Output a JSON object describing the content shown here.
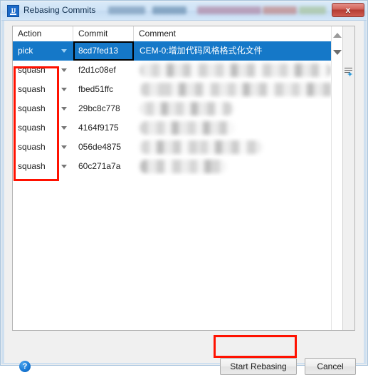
{
  "window": {
    "title": "Rebasing Commits",
    "app_icon": "intellij-idea-icon",
    "close_label": "x",
    "redacted_title_suffix": true
  },
  "table": {
    "columns": [
      "Action",
      "Commit",
      "Comment"
    ],
    "rows": [
      {
        "action": "pick",
        "commit": "8cd7fed13",
        "comment": "CEM-0:增加代码风格格式化文件",
        "selected": true,
        "comment_redacted": false,
        "focused_cell": "commit"
      },
      {
        "action": "squash",
        "commit": "f2d1c08ef",
        "comment": "",
        "selected": false,
        "comment_redacted": true,
        "comment_width": 270
      },
      {
        "action": "squash",
        "commit": "fbed51ffc",
        "comment": "",
        "selected": false,
        "comment_redacted": true,
        "comment_width": 278
      },
      {
        "action": "squash",
        "commit": "29bc8c778",
        "comment": "",
        "selected": false,
        "comment_redacted": true,
        "comment_width": 132
      },
      {
        "action": "squash",
        "commit": "4164f9175",
        "comment": "",
        "selected": false,
        "comment_redacted": true,
        "comment_width": 134
      },
      {
        "action": "squash",
        "commit": "056de4875",
        "comment": "",
        "selected": false,
        "comment_redacted": true,
        "comment_width": 172
      },
      {
        "action": "squash",
        "commit": "60c271a7a",
        "comment": "",
        "selected": false,
        "comment_redacted": true,
        "comment_width": 122
      }
    ]
  },
  "scrollbar": {
    "up_icon": "triangle-up-icon",
    "down_icon": "triangle-down-icon"
  },
  "side_toolbar": {
    "speed_search_icon": "speed-search-icon",
    "spark": "✦"
  },
  "footer": {
    "help_icon": "help-icon",
    "help_glyph": "?",
    "start_label": "Start Rebasing",
    "cancel_label": "Cancel"
  },
  "annotations": [
    {
      "name": "action-column-highlight",
      "color": "#ff1100"
    },
    {
      "name": "start-rebasing-highlight",
      "color": "#ff1100"
    }
  ],
  "colors": {
    "selection": "#1578c8",
    "annotation": "#ff1100",
    "titlebar": "#cfe3f6",
    "close_button": "#b63d34"
  }
}
